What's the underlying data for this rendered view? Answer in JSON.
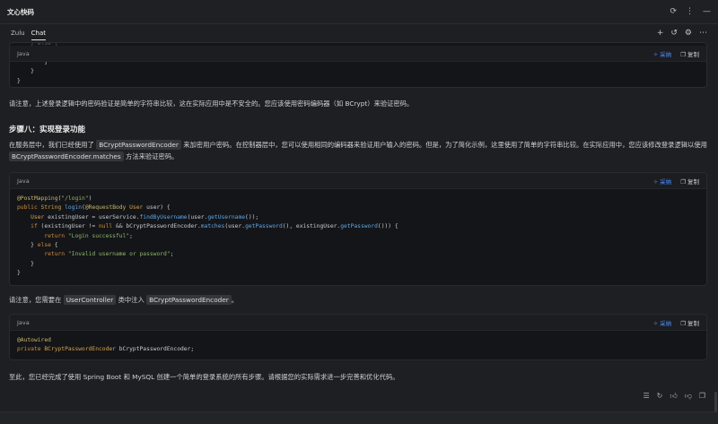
{
  "app": {
    "title": "文心快码"
  },
  "titlebar_icons": [
    "sync-icon",
    "more-vertical-icon",
    "minimize-icon"
  ],
  "tabs": [
    {
      "label": "Zulu",
      "active": false
    },
    {
      "label": "Chat",
      "active": true
    }
  ],
  "tab_icons": [
    "plus-icon",
    "history-icon",
    "gear-icon",
    "more-horizontal-icon"
  ],
  "code_actions": {
    "adopt": "采纳",
    "copy": "复制"
  },
  "block1": {
    "lang": "Java"
  },
  "para1": "请注意，上述登录逻辑中的密码验证是简单的字符串比较，这在实际应用中是不安全的。您应该使用密码编码器（如 BCrypt）来验证密码。",
  "heading": "步骤八：实现登录功能",
  "para2": {
    "part1": "在服务层中，我们已经使用了",
    "code1": "BCryptPasswordEncoder",
    "part2": "来加密用户密码。在控制器层中，您可以使用相同的编码器来验证用户输入的密码。但是，为了简化示例，这里使用了简单的字符串比较。在实际应用中，您应该修改登录逻辑以使用",
    "code2": "BCryptPasswordEncoder.matches",
    "part3": "方法来验证密码。"
  },
  "block2": {
    "lang": "Java"
  },
  "para3": {
    "part1": "请注意，您需要在",
    "code1": "UserController",
    "part2": "类中注入",
    "code2": "BCryptPasswordEncoder",
    "part3": "。"
  },
  "block3": {
    "lang": "Java"
  },
  "para4": "至此，您已经完成了使用 Spring Boot 和 MySQL 创建一个简单的登录系统的所有步骤。请根据您的实际需求进一步完善和优化代码。",
  "footer_icons": [
    "stack-icon",
    "refresh-icon",
    "thumbs-up-icon",
    "thumbs-down-icon",
    "copy-icon"
  ]
}
